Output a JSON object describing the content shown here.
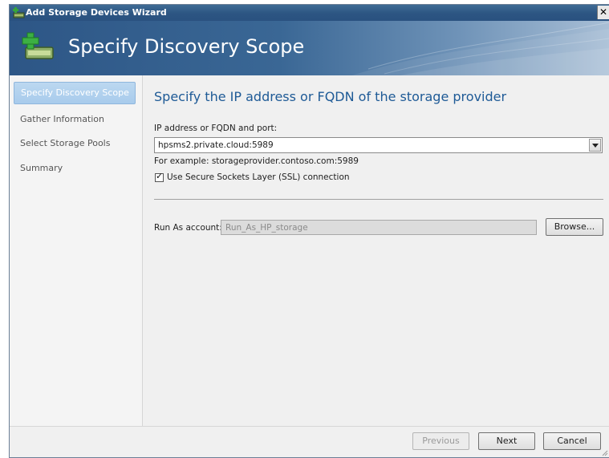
{
  "window": {
    "title": "Add Storage Devices Wizard",
    "close_glyph": "✕"
  },
  "banner": {
    "title": "Specify Discovery Scope",
    "icon": "add-storage-icon"
  },
  "nav": {
    "items": [
      {
        "label": "Specify Discovery Scope",
        "active": true
      },
      {
        "label": "Gather Information",
        "active": false
      },
      {
        "label": "Select Storage Pools",
        "active": false
      },
      {
        "label": "Summary",
        "active": false
      }
    ]
  },
  "main": {
    "heading": "Specify the IP address or FQDN of the storage provider",
    "address_label": "IP address or FQDN and port:",
    "address_value": "hpsms2.private.cloud:5989",
    "example_text": "For example: storageprovider.contoso.com:5989",
    "ssl_label": "Use Secure Sockets Layer (SSL) connection",
    "ssl_checked": true,
    "runas_label": "Run As account:",
    "runas_value": "Run_As_HP_storage",
    "browse_label": "Browse..."
  },
  "footer": {
    "previous_label": "Previous",
    "next_label": "Next",
    "cancel_label": "Cancel"
  },
  "colors": {
    "titlebar": "#2c5582",
    "heading": "#1e5a96",
    "nav_active": "#a8cbec"
  }
}
